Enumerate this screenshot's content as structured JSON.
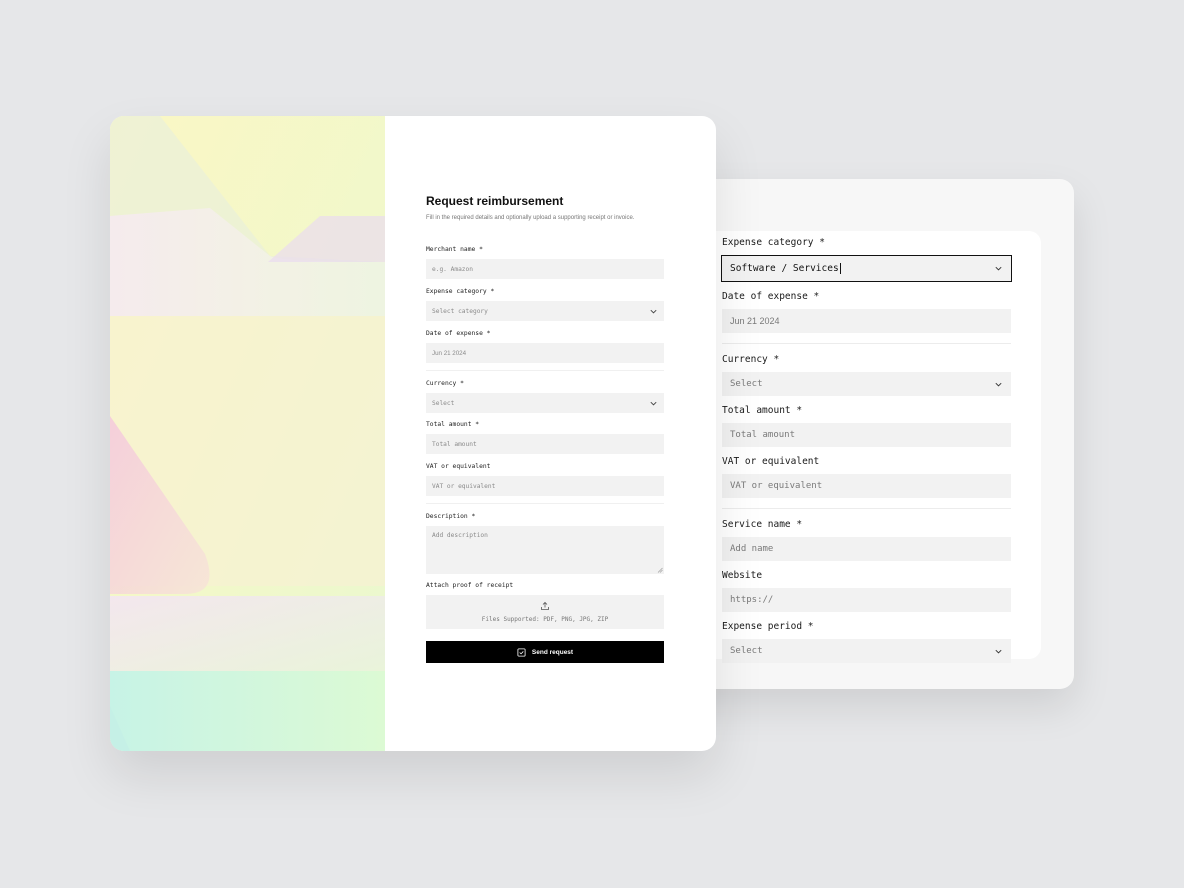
{
  "detail": {
    "expense_category": {
      "label": "Expense category *",
      "value": "Software / Services"
    },
    "date_of_expense": {
      "label": "Date of expense *",
      "value": "Jun 21 2024"
    },
    "currency": {
      "label": "Currency *",
      "placeholder": "Select"
    },
    "total_amount": {
      "label": "Total amount *",
      "placeholder": "Total amount"
    },
    "vat": {
      "label": "VAT or equivalent",
      "placeholder": "VAT or equivalent"
    },
    "service_name": {
      "label": "Service name *",
      "placeholder": "Add name"
    },
    "website": {
      "label": "Website",
      "placeholder": "https://"
    },
    "expense_period": {
      "label": "Expense period *",
      "placeholder": "Select"
    }
  },
  "form": {
    "title": "Request reimbursement",
    "subtitle": "Fill in the required details and optionally upload a supporting receipt or invoice.",
    "merchant_name": {
      "label": "Merchant name *",
      "placeholder": "e.g. Amazon"
    },
    "expense_category": {
      "label": "Expense category *",
      "placeholder": "Select category"
    },
    "date_of_expense": {
      "label": "Date of expense *",
      "value": "Jun 21 2024"
    },
    "currency": {
      "label": "Currency *",
      "placeholder": "Select"
    },
    "total_amount": {
      "label": "Total amount *",
      "placeholder": "Total amount"
    },
    "vat": {
      "label": "VAT or equivalent",
      "placeholder": "VAT or equivalent"
    },
    "description": {
      "label": "Description *",
      "placeholder": "Add description"
    },
    "attachment": {
      "label": "Attach proof of receipt",
      "hint": "Files Supported: PDF, PNG, JPG, ZIP"
    },
    "submit_label": "Send request"
  },
  "colors": {
    "background": "#e6e7e9",
    "field": "#f2f2f2",
    "primary": "#000000",
    "active_border": "#111111"
  },
  "icons": {
    "select": "chevron-down-icon",
    "upload": "upload-icon",
    "submit": "check-square-icon",
    "resize": "resize-handle-icon"
  }
}
